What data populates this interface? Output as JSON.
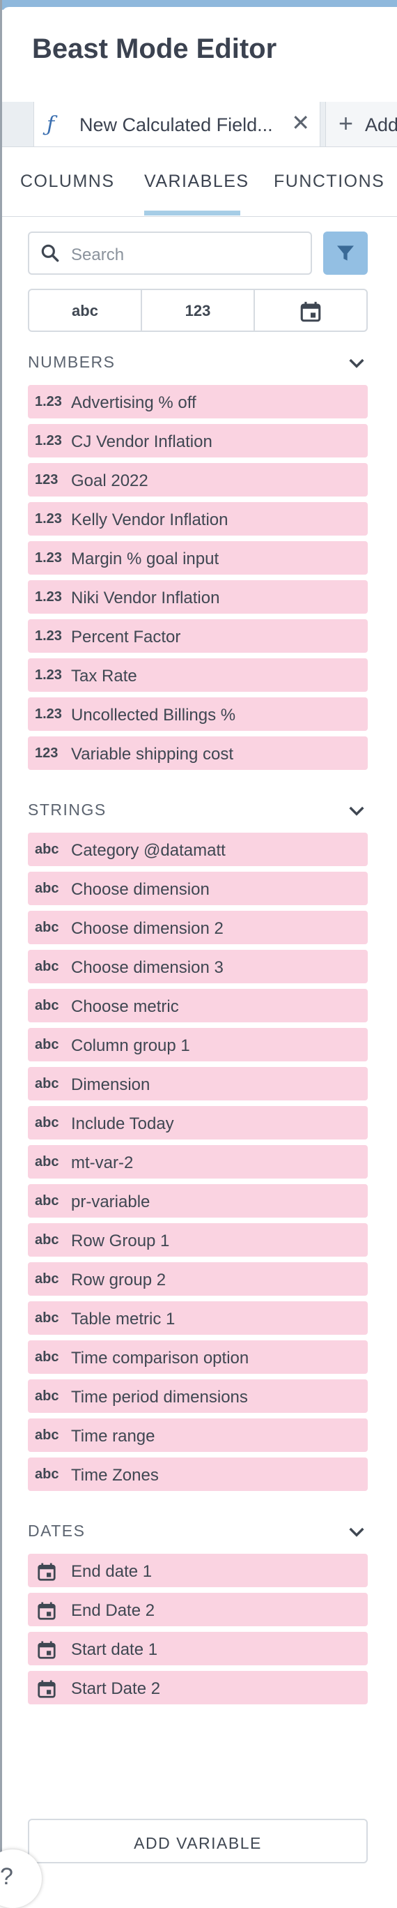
{
  "panel": {
    "title": "Beast Mode Editor"
  },
  "tabs": {
    "active_icon": "ƒ",
    "active_label": "New Calculated Field...",
    "close_glyph": "✕",
    "add_label": "Add"
  },
  "nav": {
    "columns": "COLUMNS",
    "variables": "VARIABLES",
    "functions": "FUNCTIONS",
    "active": "VARIABLES"
  },
  "search": {
    "placeholder": "Search"
  },
  "type_filter": {
    "string": "abc",
    "number": "123",
    "date": "calendar-icon"
  },
  "sections": {
    "numbers": {
      "title": "NUMBERS",
      "items": [
        {
          "badge": "1.23",
          "name": "Advertising % off"
        },
        {
          "badge": "1.23",
          "name": "CJ Vendor Inflation"
        },
        {
          "badge": "123",
          "name": "Goal 2022"
        },
        {
          "badge": "1.23",
          "name": "Kelly Vendor Inflation"
        },
        {
          "badge": "1.23",
          "name": "Margin % goal input"
        },
        {
          "badge": "1.23",
          "name": "Niki Vendor Inflation"
        },
        {
          "badge": "1.23",
          "name": "Percent Factor"
        },
        {
          "badge": "1.23",
          "name": "Tax Rate"
        },
        {
          "badge": "1.23",
          "name": "Uncollected Billings %"
        },
        {
          "badge": "123",
          "name": "Variable shipping cost"
        }
      ]
    },
    "strings": {
      "title": "STRINGS",
      "items": [
        {
          "badge": "abc",
          "name": "Category @datamatt"
        },
        {
          "badge": "abc",
          "name": "Choose dimension"
        },
        {
          "badge": "abc",
          "name": "Choose dimension 2"
        },
        {
          "badge": "abc",
          "name": "Choose dimension 3"
        },
        {
          "badge": "abc",
          "name": "Choose metric"
        },
        {
          "badge": "abc",
          "name": "Column group 1"
        },
        {
          "badge": "abc",
          "name": "Dimension"
        },
        {
          "badge": "abc",
          "name": "Include Today"
        },
        {
          "badge": "abc",
          "name": "mt-var-2"
        },
        {
          "badge": "abc",
          "name": "pr-variable"
        },
        {
          "badge": "abc",
          "name": "Row Group 1"
        },
        {
          "badge": "abc",
          "name": "Row group 2"
        },
        {
          "badge": "abc",
          "name": "Table metric 1"
        },
        {
          "badge": "abc",
          "name": "Time comparison option"
        },
        {
          "badge": "abc",
          "name": "Time period dimensions"
        },
        {
          "badge": "abc",
          "name": "Time range"
        },
        {
          "badge": "abc",
          "name": "Time Zones"
        }
      ]
    },
    "dates": {
      "title": "DATES",
      "items": [
        {
          "badge": "calendar-icon",
          "name": "End date 1"
        },
        {
          "badge": "calendar-icon",
          "name": "End Date 2"
        },
        {
          "badge": "calendar-icon",
          "name": "Start date 1"
        },
        {
          "badge": "calendar-icon",
          "name": "Start Date 2"
        }
      ]
    }
  },
  "footer": {
    "add_variable": "ADD VARIABLE",
    "help": "?"
  },
  "colors": {
    "accent": "#93bfe3",
    "item_bg": "#fad3e1",
    "tab_underline": "#a6cde6"
  }
}
